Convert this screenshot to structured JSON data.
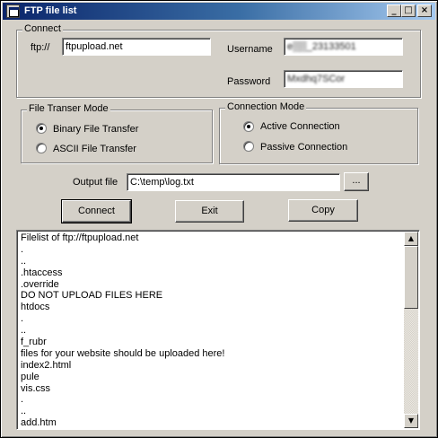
{
  "window": {
    "title": "FTP file list",
    "controls": {
      "minimize": "_",
      "maximize": "□",
      "close": "×"
    }
  },
  "connect_group": {
    "label": "Connect",
    "ftp_prefix": "ftp://",
    "host_value": "ftpupload.net",
    "username_label": "Username",
    "username_value": "e▒▒_23133501",
    "password_label": "Password",
    "password_value": "Mxdhq7SCor"
  },
  "transfer_mode": {
    "label": "File Transer Mode",
    "options": [
      {
        "label": "Binary File Transfer",
        "checked": true
      },
      {
        "label": "ASCII File Transfer",
        "checked": false
      }
    ]
  },
  "connection_mode": {
    "label": "Connection Mode",
    "options": [
      {
        "label": "Active Connection",
        "checked": true
      },
      {
        "label": "Passive Connection",
        "checked": false
      }
    ]
  },
  "output": {
    "label": "Output file",
    "value": "C:\\temp\\log.txt",
    "browse_label": "..."
  },
  "buttons": {
    "connect": "Connect",
    "exit": "Exit",
    "copy": "Copy"
  },
  "filelist": {
    "lines": [
      "Filelist of ftp://ftpupload.net",
      ".",
      "..",
      ".htaccess",
      ".override",
      "DO NOT UPLOAD FILES HERE",
      "htdocs",
      ".",
      "..",
      "f_rubr",
      "files for your website should be uploaded here!",
      "index2.html",
      "pule",
      "vis.css",
      ".",
      "..",
      "add.htm"
    ]
  },
  "scrollbar": {
    "up": "▲",
    "down": "▼"
  }
}
